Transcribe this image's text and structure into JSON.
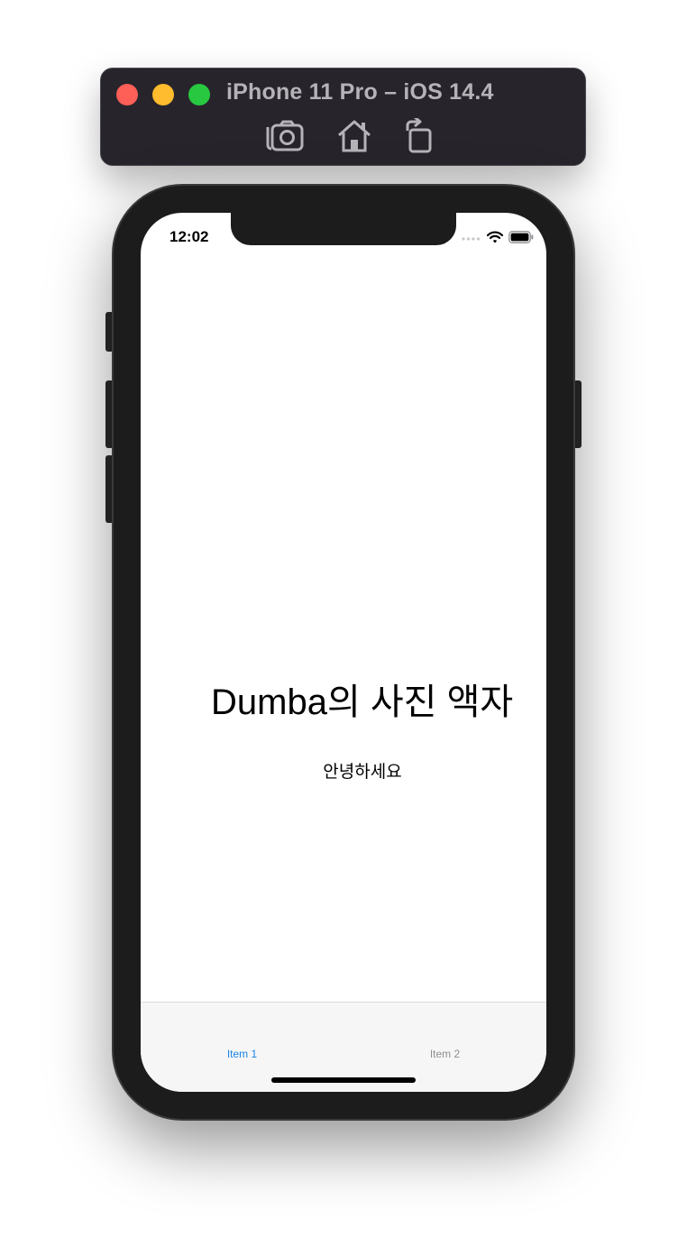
{
  "simulator": {
    "title": "iPhone 11 Pro – iOS 14.4",
    "traffic_lights": {
      "close": "#fe5f57",
      "minimize": "#febc2e",
      "zoom": "#28c840"
    },
    "tools": [
      "screenshot-icon",
      "home-icon",
      "rotate-icon"
    ]
  },
  "status_bar": {
    "time": "12:02",
    "icons": [
      "signal-icon",
      "wifi-icon",
      "battery-icon"
    ]
  },
  "main": {
    "title": "Dumba의 사진 액자",
    "subtitle": "안녕하세요"
  },
  "tab_bar": {
    "items": [
      {
        "label": "Item 1",
        "selected": true
      },
      {
        "label": "Item 2",
        "selected": false
      }
    ],
    "accent_color": "#1a84e4"
  }
}
